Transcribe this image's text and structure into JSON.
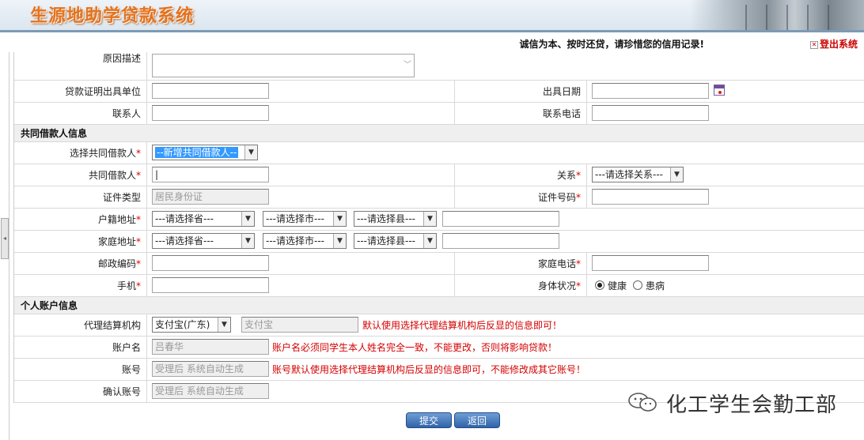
{
  "header": {
    "title": "生源地助学贷款系统",
    "slogan": "诚信为本、按时还贷，请珍惜您的信用记录!",
    "logout": "登出系统"
  },
  "loan": {
    "reason_label": "原因描述",
    "issuer_label": "贷款证明出具单位",
    "issue_date_label": "出具日期",
    "contact_label": "联系人",
    "contact_phone_label": "联系电话"
  },
  "coborrower": {
    "section_title": "共同借款人信息",
    "select_label": "选择共同借款人",
    "select_value": "--新增共同借款人--",
    "name_label": "共同借款人",
    "relation_label": "关系",
    "relation_value": "---请选择关系---",
    "id_type_label": "证件类型",
    "id_type_value": "居民身份证",
    "id_no_label": "证件号码",
    "census_label": "户籍地址",
    "home_label": "家庭地址",
    "province": "---请选择省---",
    "city": "---请选择市---",
    "county": "---请选择县---",
    "postcode_label": "邮政编码",
    "home_phone_label": "家庭电话",
    "mobile_label": "手机",
    "health_label": "身体状况",
    "health_good": "健康",
    "health_ill": "患病"
  },
  "account": {
    "section_title": "个人账户信息",
    "agent_label": "代理结算机构",
    "agent_value": "支付宝(广东)",
    "agent_readonly": "支付宝",
    "agent_hint": "默认使用选择代理结算机构后反显的信息即可！",
    "name_label": "账户名",
    "name_value": "吕春华",
    "name_hint": "账户名必须同学生本人姓名完全一致，不能更改，否则将影响贷款！",
    "no_label": "账号",
    "no_value": "受理后 系统自动生成",
    "no_hint": "账号默认使用选择代理结算机构后反显的信息即可，不能修改成其它账号！",
    "confirm_label": "确认账号",
    "confirm_value": "受理后 系统自动生成"
  },
  "buttons": {
    "submit": "提交",
    "back": "返回"
  },
  "watermark": "化工学生会勤工部",
  "required_mark": "*"
}
